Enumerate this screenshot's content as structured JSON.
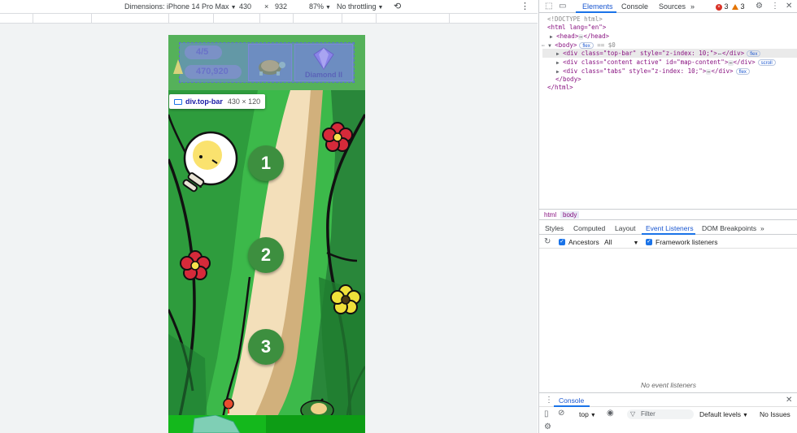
{
  "device_toolbar": {
    "dimensions_label": "Dimensions: iPhone 14 Pro Max",
    "width": "430",
    "times": "×",
    "height": "932",
    "zoom": "87%",
    "throttling": "No throttling"
  },
  "game": {
    "top_bar": {
      "progress": "4/5",
      "score": "470,920",
      "badge_label": "Diamond II"
    },
    "tooltip": {
      "tag": "div.top-bar",
      "size": "430 × 120"
    },
    "levels": [
      "1",
      "2",
      "3"
    ]
  },
  "devtools": {
    "tabs": [
      "Elements",
      "Console",
      "Sources"
    ],
    "more_tabs": "»",
    "error_count": "3",
    "warning_count": "3",
    "dom": {
      "doctype": "<!DOCTYPE html>",
      "html_open": "<html lang=\"en\">",
      "head": "<head>",
      "head_close": "</head>",
      "body_open": "<body>",
      "body_badge": "flex",
      "body_eq": "== $0",
      "div1_open": "<div class=\"top-bar\" style=\"z-index: 10;\">",
      "div1_close": "</div>",
      "div1_badge": "flex",
      "div2_open": "<div class=\"content active\" id=\"map-content\">",
      "div2_close": "</div>",
      "div2_badge": "scroll",
      "div3_open": "<div class=\"tabs\" style=\"z-index: 10;\">",
      "div3_close": "</div>",
      "div3_badge": "flex",
      "body_close": "</body>",
      "html_close": "</html>",
      "ellipsis": "…"
    },
    "breadcrumbs": [
      "html",
      "body"
    ],
    "sub_tabs": [
      "Styles",
      "Computed",
      "Layout",
      "Event Listeners",
      "DOM Breakpoints"
    ],
    "sub_more": "»",
    "ancestors_label": "Ancestors",
    "ancestors_select": "All",
    "framework_label": "Framework listeners",
    "empty_text": "No event listeners",
    "drawer": {
      "title": "Console",
      "context": "top",
      "filter_placeholder": "Filter",
      "levels": "Default levels",
      "issues": "No Issues"
    }
  },
  "colors": {
    "accent": "#1a73e8",
    "game_green": "#3fb84a",
    "level_circle": "#3d8f3f",
    "highlight": "#6f84e6"
  }
}
